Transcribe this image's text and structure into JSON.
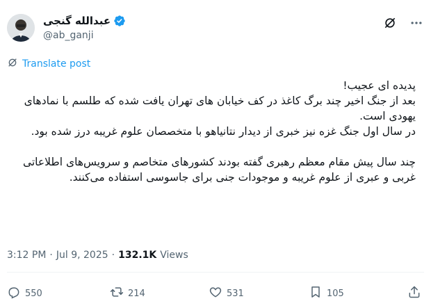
{
  "author": {
    "display_name": "عبدالله گنجی",
    "handle": "@ab_ganji",
    "verified": true
  },
  "translate_label": "Translate post",
  "tweet": {
    "paragraph1": [
      "پدیده ای عجیب!",
      "بعد از جنگ اخیر چند برگ کاغذ در کف خیابان های تهران یافت شده که طلسم با نمادهای یهودی است.",
      "در سال اول جنگ غزه نیز خبری از دیدار نتانیاهو با متخصصان علوم غریبه درز شده بود."
    ],
    "paragraph2": "چند سال پیش مقام معظم رهبری گفته بودند کشورهای متخاصم و سرویس‌های اطلاعاتی غربی و عبری از علوم غریبه و موجودات جنی برای جاسوسی استفاده می‌کنند."
  },
  "meta": {
    "time": "3:12 PM",
    "date": "Jul 9, 2025",
    "separator": "·",
    "views_count": "132.1K",
    "views_label": "Views"
  },
  "actions": {
    "replies": "550",
    "reposts": "214",
    "likes": "531",
    "bookmarks": "105"
  },
  "colors": {
    "accent": "#1d9bf0",
    "muted": "#536471",
    "text": "#0f1419"
  },
  "icons": {
    "verified": "verified-badge-icon",
    "grok": "grok-icon",
    "more": "more-options-icon",
    "translate": "translate-icon",
    "reply": "reply-icon",
    "repost": "repost-icon",
    "like": "heart-icon",
    "bookmark": "bookmark-icon",
    "share": "share-icon"
  }
}
